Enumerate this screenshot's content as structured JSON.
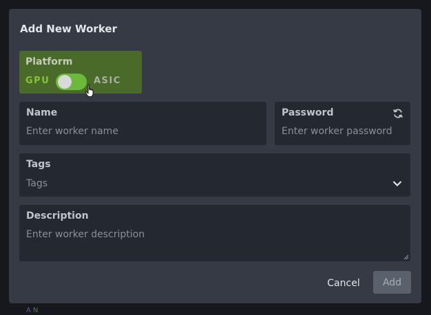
{
  "modal": {
    "title": "Add New Worker"
  },
  "platform": {
    "label": "Platform",
    "option_left": "GPU",
    "option_right": "ASIC",
    "selected": "GPU",
    "toggle_color": "#6cba3b"
  },
  "fields": {
    "name": {
      "label": "Name",
      "placeholder": "Enter worker name"
    },
    "password": {
      "label": "Password",
      "placeholder": "Enter worker password",
      "icon": "refresh-icon"
    },
    "tags": {
      "label": "Tags",
      "placeholder": "Tags",
      "icon": "chevron-down-icon"
    },
    "description": {
      "label": "Description",
      "placeholder": "Enter worker description"
    }
  },
  "actions": {
    "cancel_label": "Cancel",
    "add_label": "Add"
  },
  "backdrop": {
    "corner_glyph": "A",
    "corner_text": "N"
  }
}
